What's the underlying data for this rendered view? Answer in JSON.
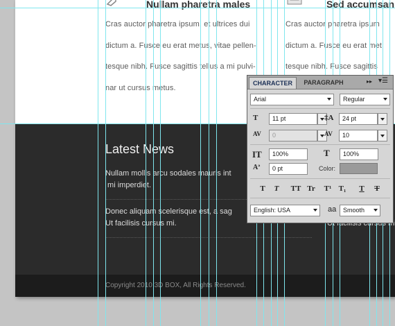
{
  "page": {
    "left_column": {
      "title": "Nullam pharetra males",
      "lines": [
        "Cras auctor pharetra ipsum, et ultrices dui",
        "dictum a. Fusce eu erat metus, vitae pellen-",
        "tesque nibh. Fusce sagittis tellus a mi pulvi-",
        "nar ut cursus metus."
      ]
    },
    "right_column": {
      "title": "Sed accumsan",
      "lines": [
        "Cras auctor pharetra ipsum",
        "dictum a. Fusce eu erat met",
        "tesque nibh. Fusce sagittis"
      ]
    },
    "news": {
      "title": "Latest News",
      "items": [
        {
          "line1": "Nullam mollis arcu sodales mauris int",
          "line2": " mi imperdiet."
        },
        {
          "line1": "Donec aliquam scelerisque est, a sag",
          "line2": "Ut facilisis cursus mi."
        }
      ],
      "right_fragment": "Ut facilisis cursus mi."
    },
    "footer": {
      "copyright": "Copyright 2010 3D BOX, All Rights Reserved."
    }
  },
  "character_panel": {
    "tabs": [
      "CHARACTER",
      "PARAGRAPH"
    ],
    "font_family": "Arial",
    "font_style": "Regular",
    "font_size": "11 pt",
    "leading": "24 pt",
    "kerning": "0",
    "tracking": "10",
    "vertical_scale": "100%",
    "horizontal_scale": "100%",
    "baseline_shift": "0 pt",
    "color_label": "Color:",
    "color_swatch": "#9a9a9a",
    "style_buttons": [
      "T",
      "T",
      "TT",
      "Tr",
      "T¹",
      "T₁",
      "T",
      "T"
    ],
    "language": "English: USA",
    "antialias": "Smooth",
    "aa_icon": "aa"
  },
  "colors": {
    "guide": "#7fe6ee",
    "dark_section": "#2b2b2b",
    "canvas": "#c4c4c4"
  }
}
